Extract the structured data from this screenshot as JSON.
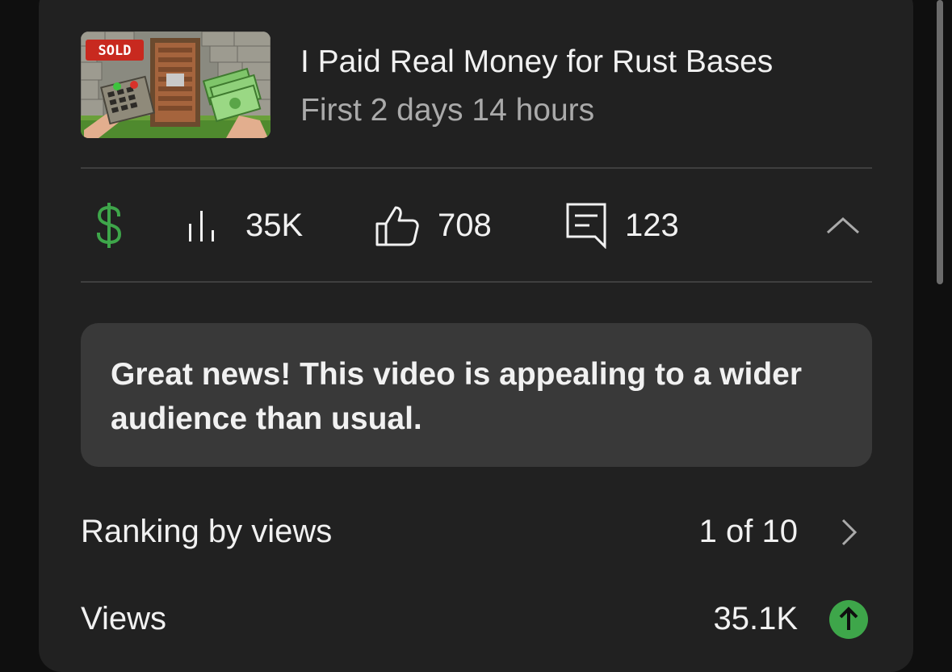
{
  "video": {
    "title": "I Paid Real Money for Rust Bases",
    "period": "First 2 days 14 hours",
    "thumbnail": {
      "badge": "SOLD"
    }
  },
  "stats": {
    "monetization_icon": "dollar-icon",
    "views": "35K",
    "likes": "708",
    "comments": "123"
  },
  "banner": {
    "message": "Great news! This video is appealing to a wider audience than usual."
  },
  "metrics": {
    "ranking": {
      "label": "Ranking by views",
      "value": "1 of 10"
    },
    "views": {
      "label": "Views",
      "value": "35.1K",
      "trend": "up"
    }
  },
  "colors": {
    "background": "#0f0f0f",
    "card": "#212121",
    "banner": "#393939",
    "accent_green": "#3ea64a",
    "secondary_text": "#aaaaaa"
  }
}
